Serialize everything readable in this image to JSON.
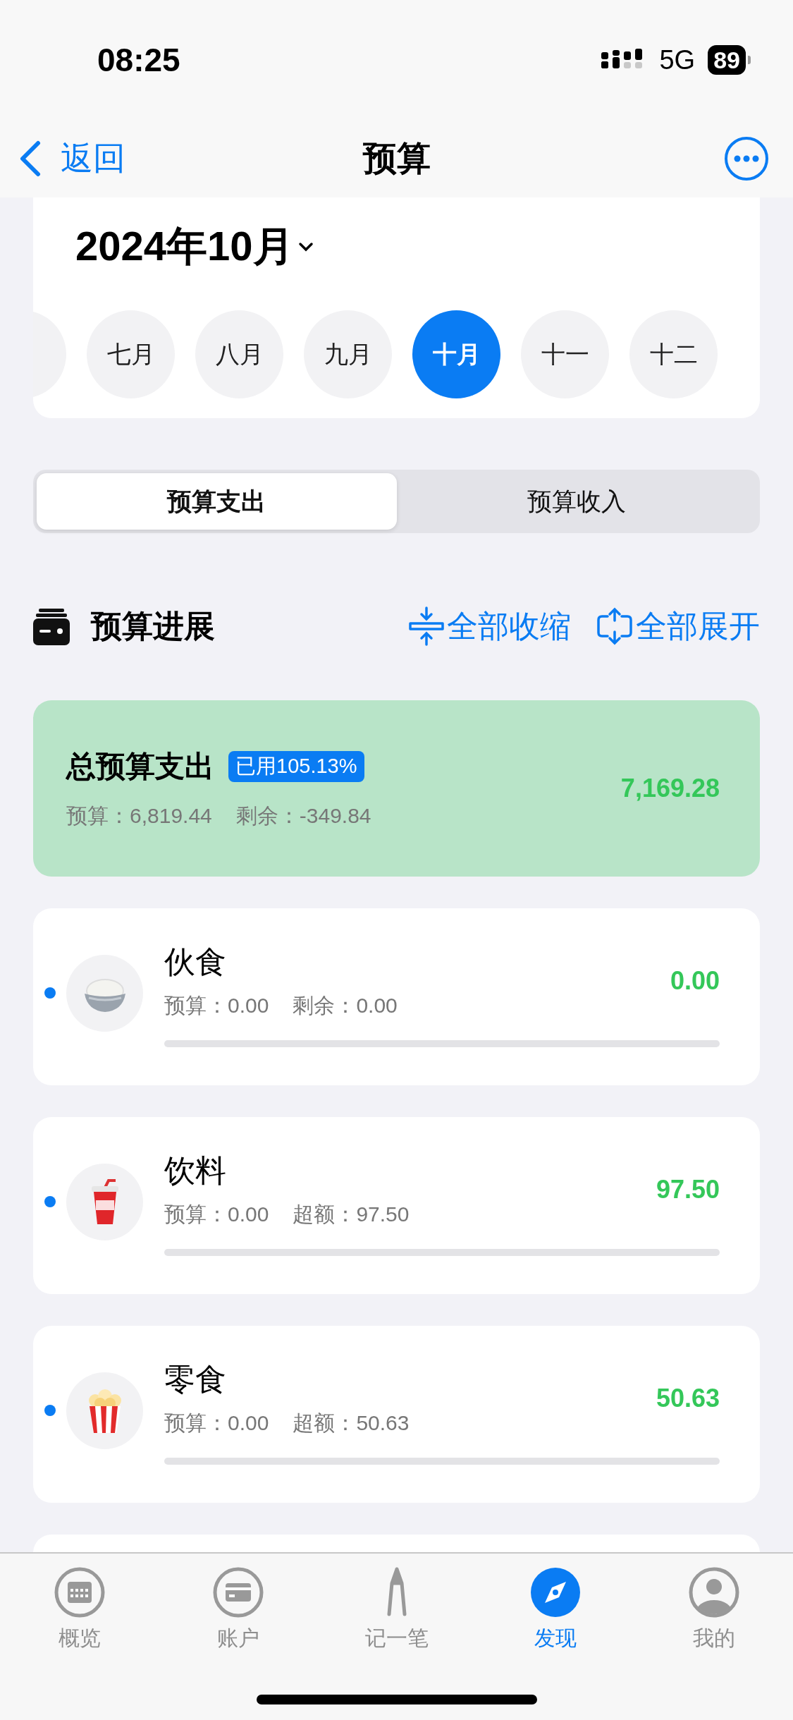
{
  "status_bar": {
    "time": "08:25",
    "network": "5G",
    "battery": "89"
  },
  "nav": {
    "back": "返回",
    "title": "预算"
  },
  "period": {
    "title": "2024年10月",
    "months": [
      {
        "label": "七月",
        "selected": false
      },
      {
        "label": "八月",
        "selected": false
      },
      {
        "label": "九月",
        "selected": false
      },
      {
        "label": "十月",
        "selected": true
      },
      {
        "label": "十一",
        "selected": false
      },
      {
        "label": "十二",
        "selected": false
      }
    ]
  },
  "segments": [
    {
      "label": "预算支出",
      "selected": true
    },
    {
      "label": "预算收入",
      "selected": false
    }
  ],
  "section": {
    "title": "预算进展",
    "actions": [
      {
        "label": "全部收缩",
        "kind": "collapse"
      },
      {
        "label": "全部展开",
        "kind": "expand"
      }
    ]
  },
  "total": {
    "title": "总预算支出",
    "badge": "已用105.13%",
    "budget": "预算：6,819.44",
    "balance": "剩余：-349.84",
    "amount": "7,169.28"
  },
  "categories": [
    {
      "name": "伙食",
      "kind": "rice",
      "budget": "预算：0.00",
      "balance": "剩余：0.00",
      "amount": "0.00",
      "level": 0
    },
    {
      "name": "饮料",
      "kind": "drink",
      "budget": "预算：0.00",
      "balance": "超额：97.50",
      "amount": "97.50",
      "level": 0
    },
    {
      "name": "零食",
      "kind": "popcorn",
      "budget": "预算：0.00",
      "balance": "超额：50.63",
      "amount": "50.63",
      "level": 0
    }
  ],
  "tabs": [
    {
      "label": "概览",
      "kind": "calendar",
      "selected": false
    },
    {
      "label": "账户",
      "kind": "card",
      "selected": false
    },
    {
      "label": "记一笔",
      "kind": "pen",
      "selected": false
    },
    {
      "label": "发现",
      "kind": "compass",
      "selected": true
    },
    {
      "label": "我的",
      "kind": "person",
      "selected": false
    }
  ]
}
